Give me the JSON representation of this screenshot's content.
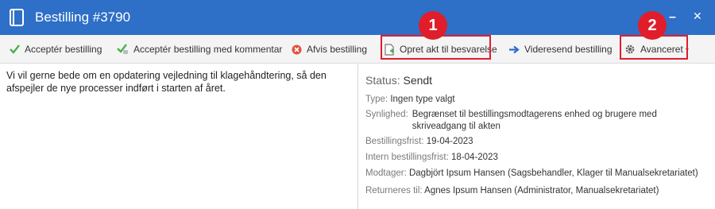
{
  "window": {
    "title": "Bestilling #3790",
    "minimize_glyph": "–",
    "close_glyph": "✕"
  },
  "toolbar": {
    "accept": "Acceptér bestilling",
    "accept_comment": "Acceptér bestilling med kommentar",
    "reject": "Afvis bestilling",
    "create_doc": "Opret akt til besvarelse",
    "forward": "Videresend bestilling",
    "advanced": "Avanceret",
    "advanced_caret": "▾"
  },
  "callouts": {
    "one": "1",
    "two": "2"
  },
  "message": "Vi vil gerne bede om en opdatering vejledning til klagehåndtering, så den afspejler de nye processer indført i starten af året.",
  "details": {
    "status_label": "Status:",
    "status_value": "Sendt",
    "type_label": "Type:",
    "type_value": "Ingen type valgt",
    "visibility_label": "Synlighed:",
    "visibility_value": "Begrænset til bestillingsmodtagerens enhed og brugere med skriveadgang til akten",
    "deadline_label": "Bestillingsfrist:",
    "deadline_value": "19-04-2023",
    "internal_deadline_label": "Intern bestillingsfrist:",
    "internal_deadline_value": "18-04-2023",
    "recipient_label": "Modtager:",
    "recipient_value": "Dagbjört Ipsum Hansen (Sagsbehandler, Klager til Manualsekretariatet)",
    "return_label": "Returneres til:",
    "return_value": "Agnes Ipsum Hansen (Administrator, Manualsekretariatet)"
  },
  "colors": {
    "titlebar": "#2e6fc7",
    "highlight": "#e01e2b",
    "accept_green": "#4caf50",
    "reject_red": "#e0533d",
    "forward_blue": "#2e6fc7"
  },
  "icons": [
    "book-icon",
    "check-icon",
    "check-comment-icon",
    "reject-icon",
    "new-document-icon",
    "arrow-right-icon",
    "gear-icon"
  ]
}
